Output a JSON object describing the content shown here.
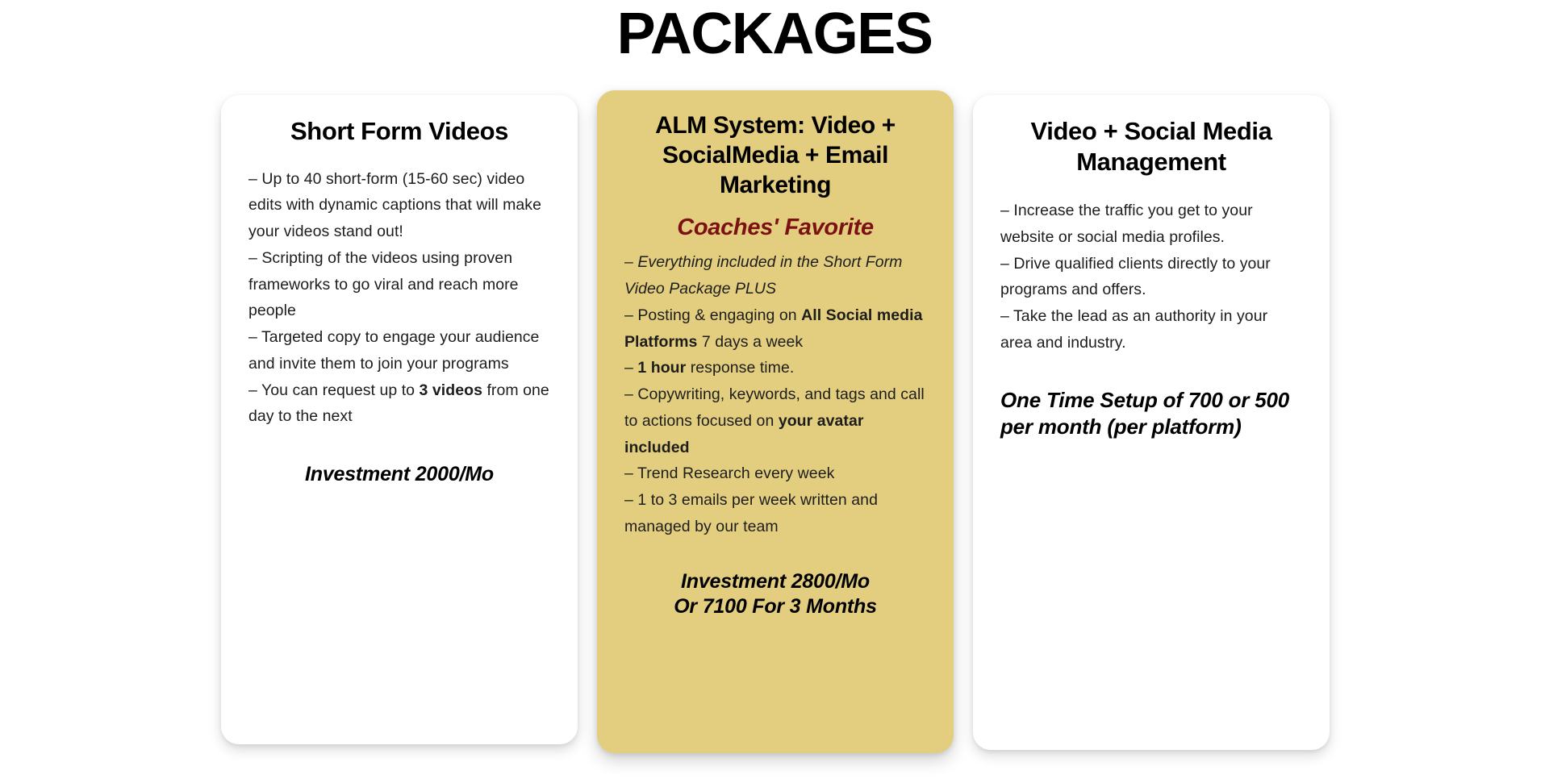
{
  "page": {
    "title": "PACKAGES",
    "accent_color": "#e3ce7f",
    "favorite_color": "#7b1113",
    "text_color": "#1d1d1b"
  },
  "packages": [
    {
      "id": "short-form-videos",
      "heading": "Short Form Videos",
      "highlighted": false,
      "bullets": [
        {
          "prefix": "– Up to 40 short-form (15-60 sec) video edits with dynamic captions that will make your videos stand out!",
          "bold": "",
          "suffix": "",
          "italic": false
        },
        {
          "prefix": "– Scripting of the videos using proven frameworks to go viral and reach more people",
          "bold": "",
          "suffix": "",
          "italic": false
        },
        {
          "prefix": "– Targeted copy to engage your audience and invite them to join your programs",
          "bold": "",
          "suffix": "",
          "italic": false
        },
        {
          "prefix": "– You can request up to ",
          "bold": "3 videos",
          "suffix": " from one day to the next",
          "italic": false
        }
      ],
      "price": "Investment 2000/Mo",
      "price_align": "center"
    },
    {
      "id": "alm-system",
      "heading": "ALM System: Video + SocialMedia + Email Marketing",
      "tagline": "Coaches' Favorite",
      "highlighted": true,
      "bullets": [
        {
          "prefix": "– Everything included in the Short Form Video Package PLUS",
          "bold": "",
          "suffix": "",
          "italic": true
        },
        {
          "prefix": "– Posting & engaging on ",
          "bold": "All Social media Platforms",
          "suffix": " 7 days a week",
          "italic": false
        },
        {
          "prefix": "–  ",
          "bold": "1 hour",
          "suffix": " response time.",
          "italic": false
        },
        {
          "prefix": "– Copywriting, keywords, and tags and call to actions focused on ",
          "bold": "your avatar included",
          "suffix": "",
          "italic": false
        },
        {
          "prefix": "– Trend Research every week",
          "bold": "",
          "suffix": "",
          "italic": false
        },
        {
          "prefix": "– 1 to 3 emails per week written and managed by our team",
          "bold": "",
          "suffix": "",
          "italic": false
        }
      ],
      "price": "Investment 2800/Mo\nOr 7100 For 3 Months",
      "price_align": "center"
    },
    {
      "id": "video-social-media-management",
      "heading": "Video + Social Media Management",
      "highlighted": false,
      "bullets": [
        {
          "prefix": "– Increase the traffic you get to your website or social media profiles.",
          "bold": "",
          "suffix": "",
          "italic": false
        },
        {
          "prefix": "– Drive qualified clients directly to your programs and offers.",
          "bold": "",
          "suffix": "",
          "italic": false
        },
        {
          "prefix": "– Take the lead as an authority in your area and industry.",
          "bold": "",
          "suffix": "",
          "italic": false
        }
      ],
      "price": "One Time Setup of 700 or 500 per month (per platform)",
      "price_align": "left"
    }
  ]
}
